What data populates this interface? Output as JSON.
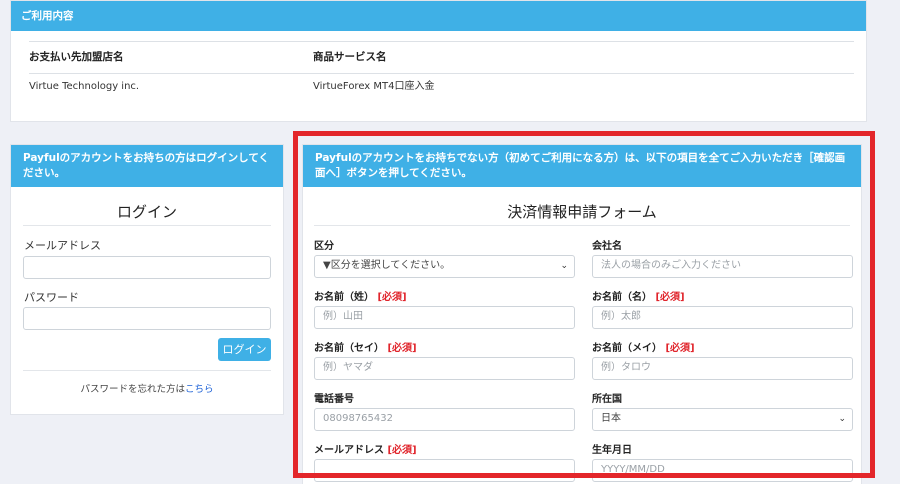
{
  "usage": {
    "header": "ご利用内容",
    "columns": [
      "お支払い先加盟店名",
      "商品サービス名"
    ],
    "row": [
      "Virtue Technology inc.",
      "VirtueForex MT4口座入金"
    ]
  },
  "login": {
    "header": "Payfulのアカウントをお持ちの方はログインしてください。",
    "title": "ログイン",
    "email_label": "メールアドレス",
    "password_label": "パスワード",
    "submit_label": "ログイン",
    "forgot_text": "パスワードを忘れた方は",
    "forgot_link": "こちら"
  },
  "form": {
    "header": "Payfulのアカウントをお持ちでない方（初めてご利用になる方）は、以下の項目を全てご入力いただき［確認画面へ］ボタンを押してください。",
    "title": "決済情報申請フォーム",
    "required_tag": "[必須]",
    "category": {
      "label": "区分",
      "value": "▼区分を選択してください。"
    },
    "company": {
      "label": "会社名",
      "placeholder": "法人の場合のみご入力ください"
    },
    "last_name": {
      "label": "お名前（姓）",
      "placeholder": "例）山田"
    },
    "first_name": {
      "label": "お名前（名）",
      "placeholder": "例）太郎"
    },
    "last_name_kana": {
      "label": "お名前（セイ）",
      "placeholder": "例）ヤマダ"
    },
    "first_name_kana": {
      "label": "お名前（メイ）",
      "placeholder": "例）タロウ"
    },
    "phone": {
      "label": "電話番号",
      "placeholder": "08098765432"
    },
    "country": {
      "label": "所在国",
      "value": "日本"
    },
    "email": {
      "label": "メールアドレス",
      "placeholder": ""
    },
    "birthdate": {
      "label": "生年月日",
      "placeholder": "YYYY/MM/DD"
    }
  },
  "colors": {
    "header_bg": "#3fb0e6",
    "highlight_border": "#e3262a",
    "required": "#e0242b",
    "link": "#1a5fd6"
  },
  "icons": {
    "select_arrow": "chevron-down-icon"
  }
}
